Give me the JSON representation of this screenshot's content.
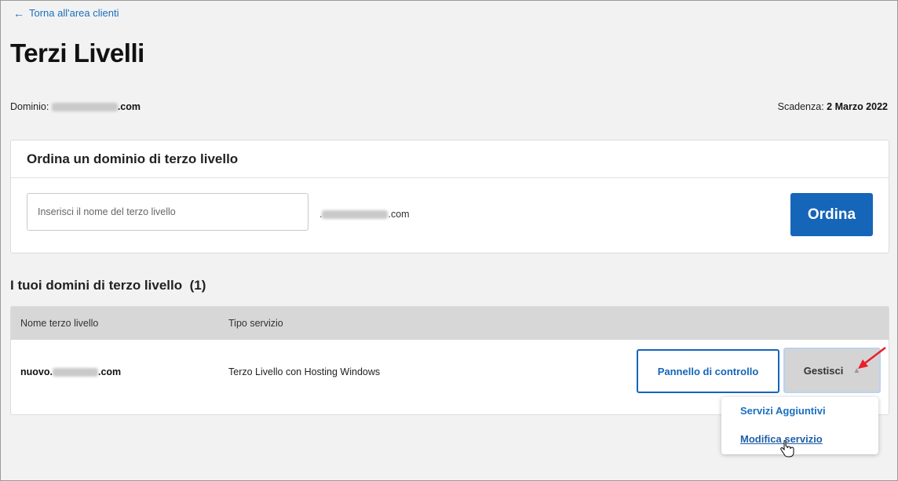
{
  "back_link": {
    "label": "Torna all'area clienti",
    "icon": "arrow-left-icon"
  },
  "page_title": "Terzi Livelli",
  "domain_info": {
    "label": "Dominio:",
    "suffix": ".com"
  },
  "expiry_info": {
    "label": "Scadenza:",
    "value": "2 Marzo 2022"
  },
  "order_card": {
    "title": "Ordina un dominio di terzo livello",
    "input_placeholder": "Inserisci il nome del terzo livello",
    "domain_prefix": ".",
    "domain_suffix": ".com",
    "order_button": "Ordina"
  },
  "list_section": {
    "title": "I tuoi domini di terzo livello",
    "count": "(1)",
    "columns": [
      "Nome terzo livello",
      "Tipo servizio"
    ],
    "rows": [
      {
        "name_prefix": "nuovo.",
        "name_suffix": ".com",
        "service_type": "Terzo Livello con Hosting Windows",
        "panel_button": "Pannello di controllo",
        "manage_button": "Gestisci"
      }
    ]
  },
  "manage_menu": {
    "items": [
      "Servizi Aggiuntivi",
      "Modifica servizio"
    ]
  },
  "colors": {
    "accent": "#1565b8",
    "link": "#1a6fbf",
    "background": "#f2f2f2",
    "table_header": "#d7d7d7",
    "annotation_arrow": "#e8202a"
  }
}
